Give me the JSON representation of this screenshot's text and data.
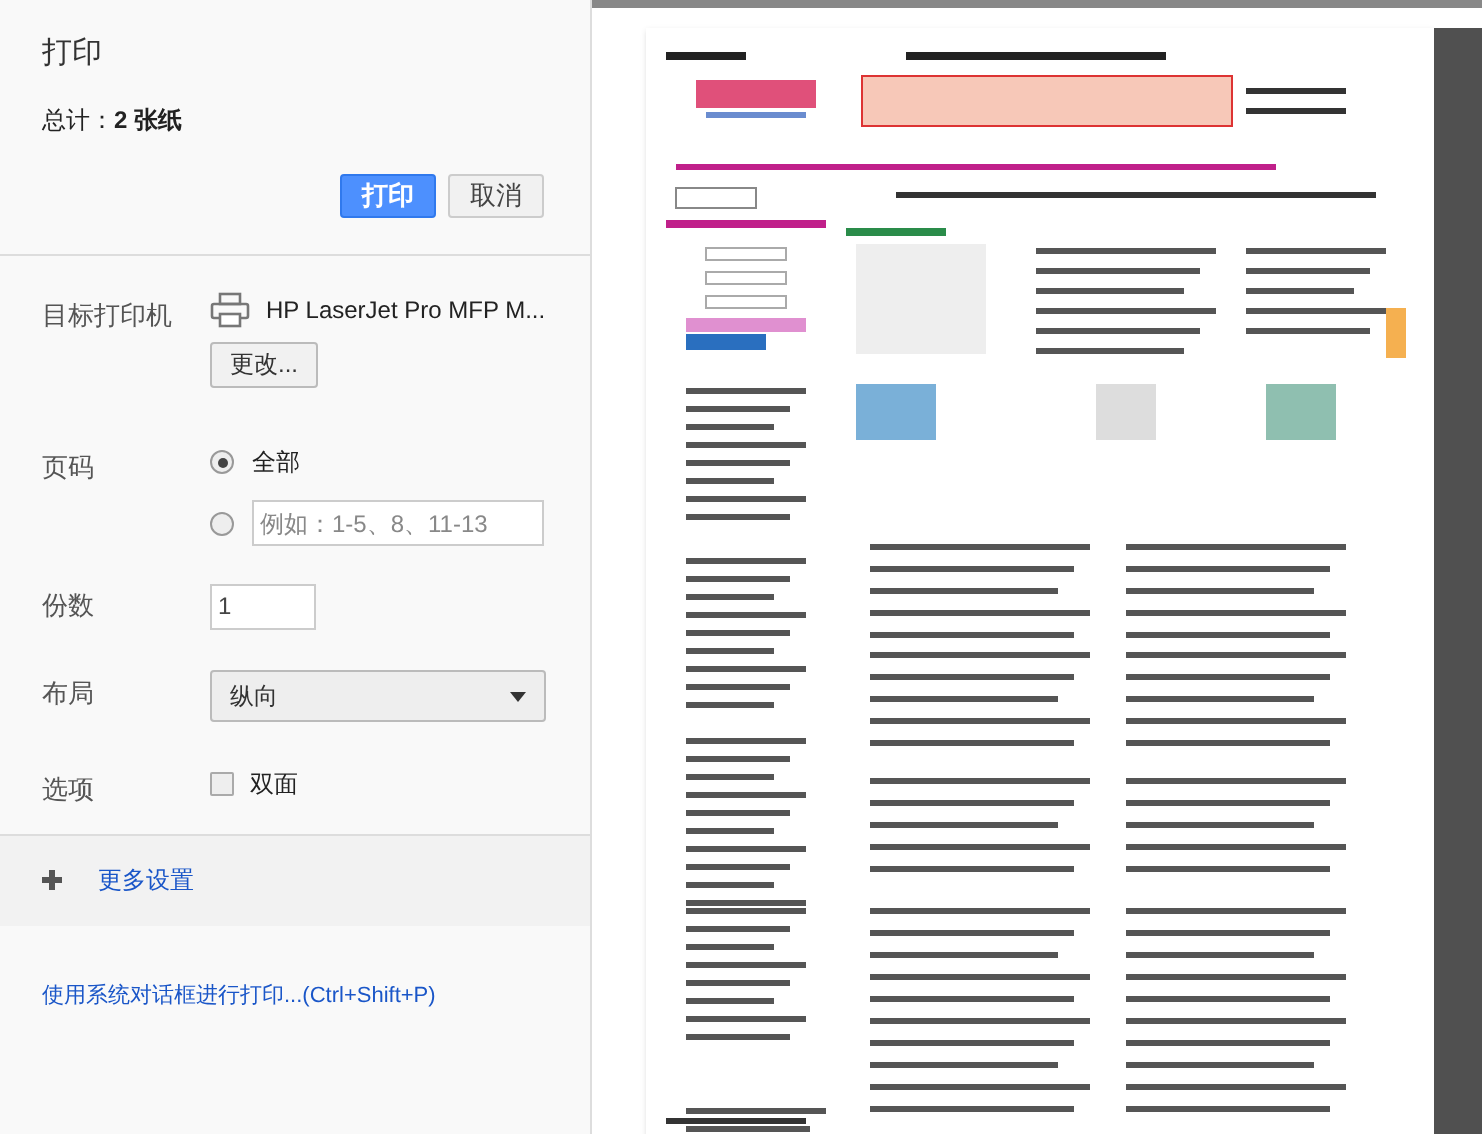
{
  "dialog": {
    "title": "打印",
    "total": "总计：**2 张纸**"
  },
  "buttons": [
    {
      "kind": "primary",
      "label": "打印"
    },
    {
      "kind": "secondary",
      "label": "取消"
    }
  ],
  "destination": {
    "label": "目标打印机",
    "printer": "HP LaserJet Pro MFP M...",
    "change_button": "更改..."
  },
  "pages": {
    "label": "页码",
    "options": [
      {
        "kind": "all",
        "label": "全部",
        "selected": true
      },
      {
        "kind": "custom",
        "placeholder": "例如：1-5、8、11-13",
        "selected": false
      }
    ]
  },
  "copies": {
    "label": "份数",
    "value": "1"
  },
  "layout": {
    "label": "布局",
    "value": "纵向"
  },
  "options": {
    "label": "选项",
    "checkboxes": [
      {
        "label": "双面",
        "checked": false
      }
    ]
  },
  "more_settings": {
    "label": "更多设置",
    "expanded": false
  },
  "system_dialog_link": "使用系统对话框进行打印...(Ctrl+Shift+P)"
}
